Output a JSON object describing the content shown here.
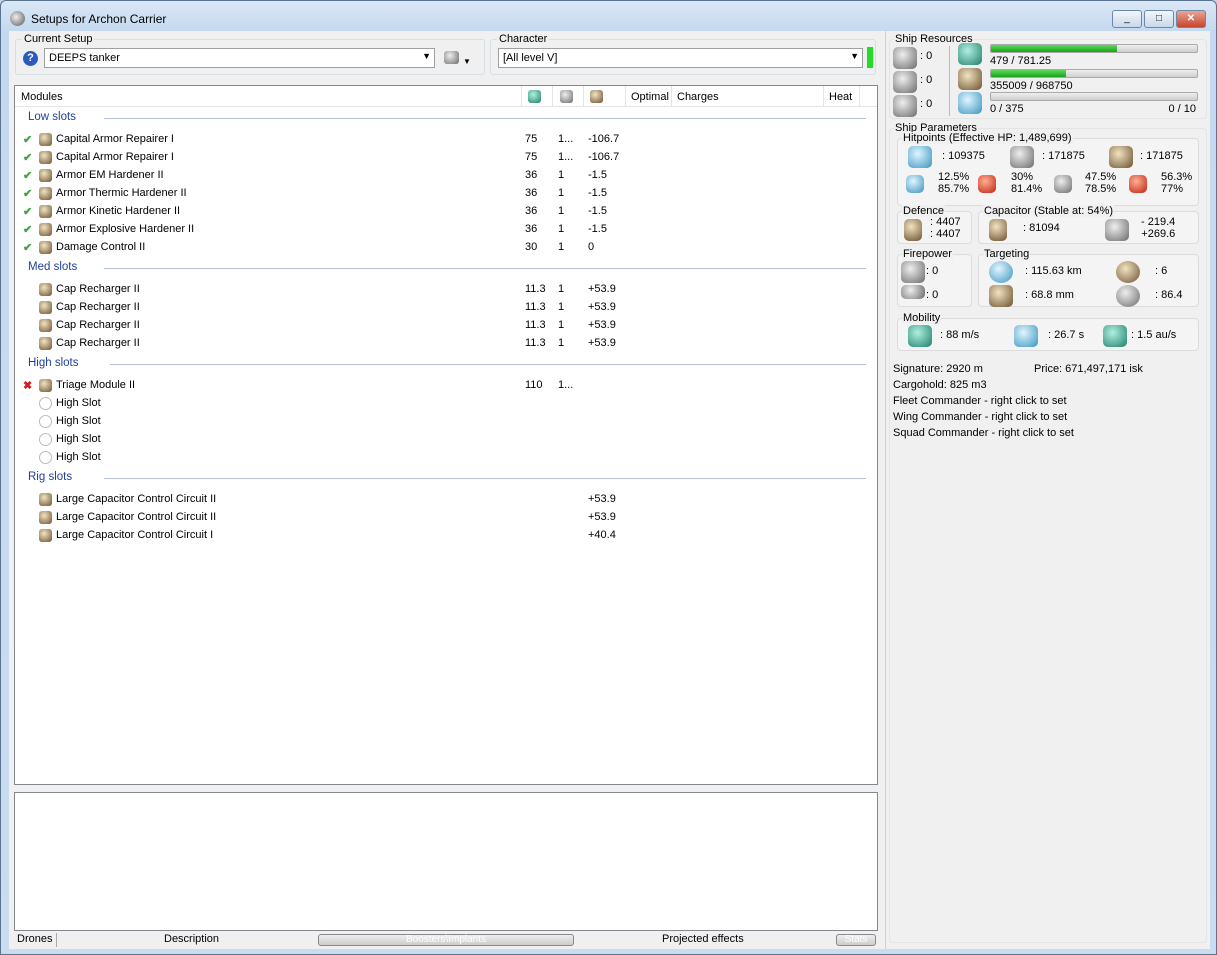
{
  "window": {
    "title": "Setups for Archon Carrier",
    "minimize": "_",
    "maximize": "□",
    "close": "✕"
  },
  "setup": {
    "label": "Current Setup",
    "value": "DEEPS tanker",
    "help_icon": "?",
    "ship_menu_icon": "ship-icon"
  },
  "character": {
    "label": "Character",
    "value": "[All level V]",
    "status_color": "#22dd22"
  },
  "modules": {
    "headers": {
      "modules": "Modules",
      "optimal": "Optimal",
      "charges": "Charges",
      "heat": "Heat"
    },
    "sections": [
      {
        "title": "Low slots",
        "rows": [
          {
            "state": "ok",
            "name": "Capital Armor Repairer I",
            "cpu": "75",
            "pg": "1...",
            "cap": "-106.7"
          },
          {
            "state": "ok",
            "name": "Capital Armor Repairer I",
            "cpu": "75",
            "pg": "1...",
            "cap": "-106.7"
          },
          {
            "state": "ok",
            "name": "Armor EM Hardener II",
            "cpu": "36",
            "pg": "1",
            "cap": "-1.5"
          },
          {
            "state": "ok",
            "name": "Armor Thermic Hardener II",
            "cpu": "36",
            "pg": "1",
            "cap": "-1.5"
          },
          {
            "state": "ok",
            "name": "Armor Kinetic Hardener II",
            "cpu": "36",
            "pg": "1",
            "cap": "-1.5"
          },
          {
            "state": "ok",
            "name": "Armor Explosive Hardener II",
            "cpu": "36",
            "pg": "1",
            "cap": "-1.5"
          },
          {
            "state": "ok",
            "name": "Damage Control II",
            "cpu": "30",
            "pg": "1",
            "cap": "0"
          }
        ]
      },
      {
        "title": "Med slots",
        "rows": [
          {
            "state": "",
            "name": "Cap Recharger II",
            "cpu": "11.3",
            "pg": "1",
            "cap": "+53.9"
          },
          {
            "state": "",
            "name": "Cap Recharger II",
            "cpu": "11.3",
            "pg": "1",
            "cap": "+53.9"
          },
          {
            "state": "",
            "name": "Cap Recharger II",
            "cpu": "11.3",
            "pg": "1",
            "cap": "+53.9"
          },
          {
            "state": "",
            "name": "Cap Recharger II",
            "cpu": "11.3",
            "pg": "1",
            "cap": "+53.9"
          }
        ]
      },
      {
        "title": "High slots",
        "rows": [
          {
            "state": "bad",
            "name": "Triage Module II",
            "cpu": "110",
            "pg": "1...",
            "cap": ""
          },
          {
            "state": "",
            "name": "High Slot",
            "cpu": "",
            "pg": "",
            "cap": ""
          },
          {
            "state": "",
            "name": "High Slot",
            "cpu": "",
            "pg": "",
            "cap": ""
          },
          {
            "state": "",
            "name": "High Slot",
            "cpu": "",
            "pg": "",
            "cap": ""
          },
          {
            "state": "",
            "name": "High Slot",
            "cpu": "",
            "pg": "",
            "cap": ""
          }
        ]
      },
      {
        "title": "Rig slots",
        "rows": [
          {
            "state": "",
            "name": "Large Capacitor Control Circuit II",
            "cpu": "",
            "pg": "",
            "cap": "+53.9"
          },
          {
            "state": "",
            "name": "Large Capacitor Control Circuit II",
            "cpu": "",
            "pg": "",
            "cap": "+53.9"
          },
          {
            "state": "",
            "name": "Large Capacitor Control Circuit I",
            "cpu": "",
            "pg": "",
            "cap": "+40.4"
          }
        ]
      }
    ]
  },
  "bottom_tabs": {
    "drones": "Drones",
    "description": "Description",
    "boosters": "Boosters\\Implants",
    "projected": "Projected effects",
    "stats": "Stats"
  },
  "resources": {
    "label": "Ship Resources",
    "turrets": ": 0",
    "launchers": ": 0",
    "drones_slots": ": 0",
    "cpu": {
      "text": "479 / 781.25",
      "fraction": 0.613
    },
    "powergrid": {
      "text": "355009 / 968750",
      "fraction": 0.366
    },
    "drone_bay": {
      "text": "0 / 375",
      "fraction": 0,
      "bandwidth": "0 / 10"
    }
  },
  "params": {
    "label": "Ship Parameters",
    "hp": {
      "label": "Hitpoints (Effective HP: 1,489,699)",
      "shield": ": 109375",
      "armor": ": 171875",
      "structure": ": 171875",
      "em": [
        "12.5%",
        "85.7%"
      ],
      "thermal": [
        "30%",
        "81.4%"
      ],
      "kinetic": [
        "47.5%",
        "78.5%"
      ],
      "explosive": [
        "56.3%",
        "77%"
      ]
    },
    "defence": {
      "label": "Defence",
      "v1": ": 4407",
      "v2": ": 4407"
    },
    "capacitor": {
      "label": "Capacitor (Stable at: 54%)",
      "amount": ": 81094",
      "use": "- 219.4",
      "recharge": "+269.6"
    },
    "firepower": {
      "label": "Firepower",
      "turret": ": 0",
      "missile": ": 0"
    },
    "targeting": {
      "label": "Targeting",
      "range": ": 115.63 km",
      "targets": ": 6",
      "resolution": ": 68.8 mm",
      "scan": ": 86.4"
    },
    "mobility": {
      "label": "Mobility",
      "speed": ": 88 m/s",
      "align": ": 26.7 s",
      "warp": ": 1.5 au/s"
    },
    "signature": "Signature: 2920 m",
    "price": "Price: 671,497,171 isk",
    "cargo": "Cargohold: 825 m3",
    "fleet": "Fleet Commander - right click to set",
    "wing": "Wing Commander - right click to set",
    "squad": "Squad Commander - right click to set"
  }
}
